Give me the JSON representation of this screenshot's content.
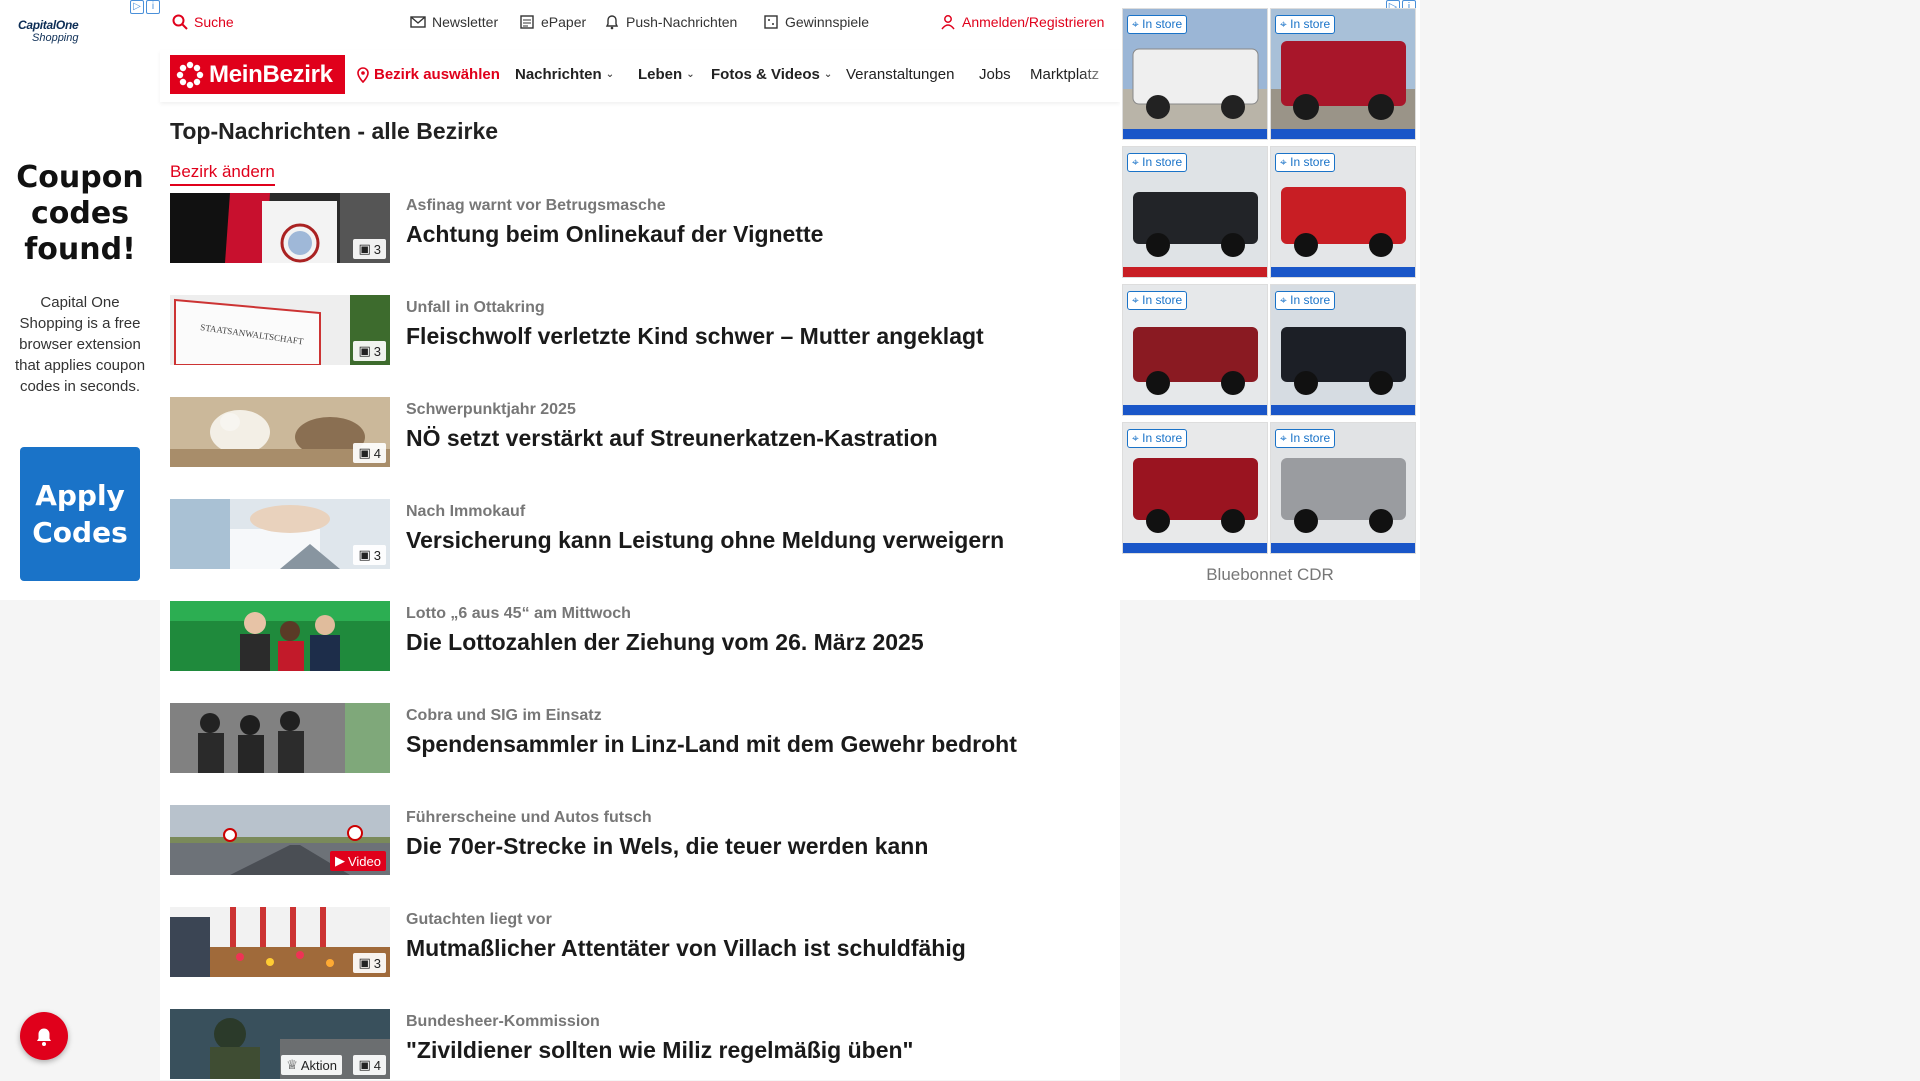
{
  "left_ad": {
    "brand": "CapitalOne",
    "brand_sub": "Shopping",
    "headline": "Coupon codes found!",
    "body": "Capital One Shopping is a free browser extension that applies coupon codes in seconds.",
    "cta": "Apply Codes",
    "accent": "#1a73c8"
  },
  "topbar": {
    "search": "Suche",
    "newsletter": "Newsletter",
    "epaper": "ePaper",
    "push": "Push-Nachrichten",
    "gewinnspiele": "Gewinnspiele",
    "login": "Anmelden/Registrieren"
  },
  "nav": {
    "logo": "MeinBezirk",
    "bezirk": "Bezirk auswählen",
    "items": [
      {
        "label": "Nachrichten",
        "dropdown": true
      },
      {
        "label": "Leben",
        "dropdown": true
      },
      {
        "label": "Fotos & Videos",
        "dropdown": true
      },
      {
        "label": "Veranstaltungen",
        "dropdown": false
      },
      {
        "label": "Jobs",
        "dropdown": false
      },
      {
        "label": "Marktplatz",
        "dropdown": false
      }
    ]
  },
  "page": {
    "title": "Top-Nachrichten - alle Bezirke",
    "change_bezirk": "Bezirk ändern"
  },
  "articles": [
    {
      "kicker": "Asfinag warnt vor Betrugsmasche",
      "headline": "Achtung beim Onlinekauf der Vignette",
      "badge": "3",
      "badge_type": "gallery"
    },
    {
      "kicker": "Unfall in Ottakring",
      "headline": "Fleischwolf verletzte Kind schwer – Mutter angeklagt",
      "badge": "3",
      "badge_type": "gallery"
    },
    {
      "kicker": "Schwerpunktjahr 2025",
      "headline": "NÖ setzt verstärkt auf Streunerkatzen-Kastration",
      "badge": "4",
      "badge_type": "gallery"
    },
    {
      "kicker": "Nach Immokauf",
      "headline": "Versicherung kann Leistung ohne Meldung verweigern",
      "badge": "3",
      "badge_type": "gallery"
    },
    {
      "kicker": "Lotto „6 aus 45“ am Mittwoch",
      "headline": "Die Lottozahlen der Ziehung vom 26. März 2025",
      "badge": "",
      "badge_type": "none"
    },
    {
      "kicker": "Cobra und SIG im Einsatz",
      "headline": "Spendensammler in Linz-Land mit dem Gewehr bedroht",
      "badge": "",
      "badge_type": "none"
    },
    {
      "kicker": "Führerscheine und Autos futsch",
      "headline": "Die 70er-Strecke in Wels, die teuer werden kann",
      "badge": "Video",
      "badge_type": "video"
    },
    {
      "kicker": "Gutachten liegt vor",
      "headline": "Mutmaßlicher Attentäter von Villach ist schuldfähig",
      "badge": "3",
      "badge_type": "gallery"
    },
    {
      "kicker": "Bundesheer-Kommission",
      "headline": "\"Zivildiener sollten wie Miliz regelmäßig üben\"",
      "badge": "4",
      "badge_type": "gallery",
      "extra_badge": "Aktion"
    }
  ],
  "right_ad": {
    "tag": "In store",
    "dealer": "Bluebonnet CDR",
    "trucks": [
      {
        "color": "#e8e8e8"
      },
      {
        "color": "#a8162a"
      },
      {
        "color": "#222428"
      },
      {
        "color": "#c81e24"
      },
      {
        "color": "#8a1a22"
      },
      {
        "color": "#1c1f26"
      },
      {
        "color": "#9a1420"
      },
      {
        "color": "#9a9ca0"
      }
    ]
  },
  "colors": {
    "brand_red": "#e0001b",
    "text": "#222222",
    "kicker": "#777777"
  }
}
